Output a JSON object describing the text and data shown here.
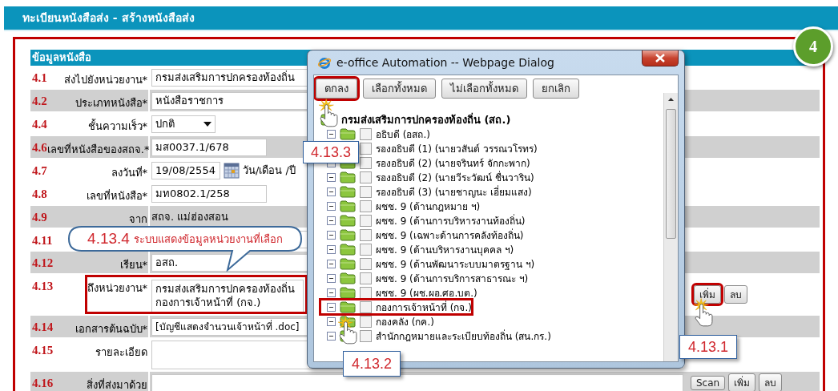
{
  "page_title": "ทะเบียนหนังสือส่ง - สร้างหนังสือส่ง",
  "step_badge": "4",
  "section_title": "ข้อมูลหนังสือ",
  "rows": [
    {
      "number": "4.1",
      "label": "ส่งไปยังหน่วยงาน*",
      "kind": "input",
      "value": "กรมส่งเสริมการปกครองท้องถิ่น",
      "shaded": false,
      "highlighted": false
    },
    {
      "number": "4.2",
      "label": "ประเภทหนังสือ*",
      "kind": "input",
      "value": "หนังสือราชการ",
      "shaded": true,
      "highlighted": false
    },
    {
      "number": "4.4",
      "label": "ชั้นความเร็ว*",
      "kind": "select",
      "value": "ปกติ",
      "shaded": false,
      "highlighted": false
    },
    {
      "number": "4.6",
      "label": "เลขที่หนังสือของสถจ.*",
      "kind": "input-short",
      "value": "มส0037.1/678",
      "shaded": true,
      "highlighted": false
    },
    {
      "number": "4.7",
      "label": "ลงวันที่*",
      "kind": "date",
      "value": "19/08/2554",
      "hint": "วัน/เดือน /ปี",
      "shaded": false,
      "highlighted": false
    },
    {
      "number": "4.8",
      "label": "เลขที่หนังสือ*",
      "kind": "input-short",
      "value": "มท0802.1/258",
      "shaded": false,
      "highlighted": false
    },
    {
      "number": "4.9",
      "label": "จาก",
      "kind": "text",
      "value": "สถจ. แม่ฮ่องสอน",
      "shaded": true,
      "highlighted": false
    },
    {
      "number": "4.11",
      "kind": "input",
      "shaded": false,
      "highlighted": false
    },
    {
      "number": "4.12",
      "label": "เรียน*",
      "kind": "input",
      "value": "อสถ.",
      "shaded": true,
      "highlighted": false
    },
    {
      "number": "4.13",
      "label": "ถึงหน่วยงาน*",
      "kind": "list",
      "lines": [
        "กรมส่งเสริมการปกครองท้องถิ่น",
        "กองการเจ้าหน้าที่ (กจ.)"
      ],
      "shaded": false,
      "highlighted": true,
      "buttons": [
        {
          "label": "เพิ่ม",
          "highlighted": true
        },
        {
          "label": "ลบ",
          "highlighted": false
        }
      ]
    },
    {
      "number": "4.14",
      "label": "เอกสารต้นฉบับ*",
      "kind": "file",
      "value": "[บัญชีแสดงจำนวนเจ้าหน้าที่ .doc]",
      "shaded": true,
      "highlighted": false
    },
    {
      "number": "4.15",
      "label": "รายละเอียด",
      "kind": "textarea",
      "shaded": false,
      "highlighted": false
    },
    {
      "number": "4.16",
      "label": "สิ่งที่ส่งมาด้วย",
      "kind": "input-long",
      "shaded": true,
      "highlighted": false,
      "buttons": [
        {
          "label": "Scan",
          "highlighted": false
        },
        {
          "label": "เพิ่ม",
          "highlighted": false
        },
        {
          "label": "ลบ",
          "highlighted": false
        }
      ]
    }
  ],
  "dialog": {
    "title": "e-office Automation -- Webpage Dialog",
    "buttons": [
      {
        "label": "ตกลง",
        "highlighted": true
      },
      {
        "label": "เลือกทั้งหมด",
        "highlighted": false
      },
      {
        "label": "ไม่เลือกทั้งหมด",
        "highlighted": false
      },
      {
        "label": "ยกเลิก",
        "highlighted": false
      }
    ],
    "tree": {
      "label": "กรมส่งเสริมการปกครองท้องถิ่น (สถ.)",
      "children": [
        {
          "label": "อธิบดี (อสถ.)",
          "checked": false,
          "highlighted": false
        },
        {
          "label": "รองอธิบดี (1) (นายวสันต์ วรรณวโรทร)",
          "checked": false,
          "highlighted": false
        },
        {
          "label": "รองอธิบดี (2) (นายจรินทร์ จักกะพาก)",
          "checked": false,
          "highlighted": false
        },
        {
          "label": "รองอธิบดี (2) (นายวีระวัฒน์ ชื่นวาริน)",
          "checked": false,
          "highlighted": false
        },
        {
          "label": "รองอธิบดี (3) (นายชาญนะ เอี่ยมแสง)",
          "checked": false,
          "highlighted": false
        },
        {
          "label": "ผชช. 9 (ด้านกฎหมาย ฯ)",
          "checked": false,
          "highlighted": false
        },
        {
          "label": "ผชช. 9 (ด้านการบริหารงานท้องถิ่น)",
          "checked": false,
          "highlighted": false
        },
        {
          "label": "ผชช. 9 (เฉพาะด้านการคลังท้องถิ่น)",
          "checked": false,
          "highlighted": false
        },
        {
          "label": "ผชช. 9 (ด้านบริหารงานบุคคล ฯ)",
          "checked": false,
          "highlighted": false
        },
        {
          "label": "ผชช. 9 (ด้านพัฒนาระบบมาตรฐาน ฯ)",
          "checked": false,
          "highlighted": false
        },
        {
          "label": "ผชช. 9 (ด้านการบริการสาธารณะ ฯ)",
          "checked": false,
          "highlighted": false
        },
        {
          "label": "ผชช. 9 (ผช.ผอ.ศอ.บต.)",
          "checked": false,
          "highlighted": false
        },
        {
          "label": "กองการเจ้าหน้าที่ (กจ.)",
          "checked": false,
          "highlighted": true
        },
        {
          "label": "กองคลัง (กค.)",
          "checked": false,
          "highlighted": false
        },
        {
          "label": "สำนักกฎหมายและระเบียบท้องถิ่น (สน.กร.)",
          "checked": false,
          "highlighted": false
        }
      ]
    }
  },
  "callouts": [
    {
      "kind": "box",
      "label": "4.13.3"
    },
    {
      "kind": "box",
      "label": "4.13.2"
    },
    {
      "kind": "box",
      "label": "4.13.1"
    },
    {
      "kind": "bubble",
      "number": "4.13.4",
      "text": "ระบบแสดงข้อมูลหน่วยงานที่เลือก"
    }
  ]
}
